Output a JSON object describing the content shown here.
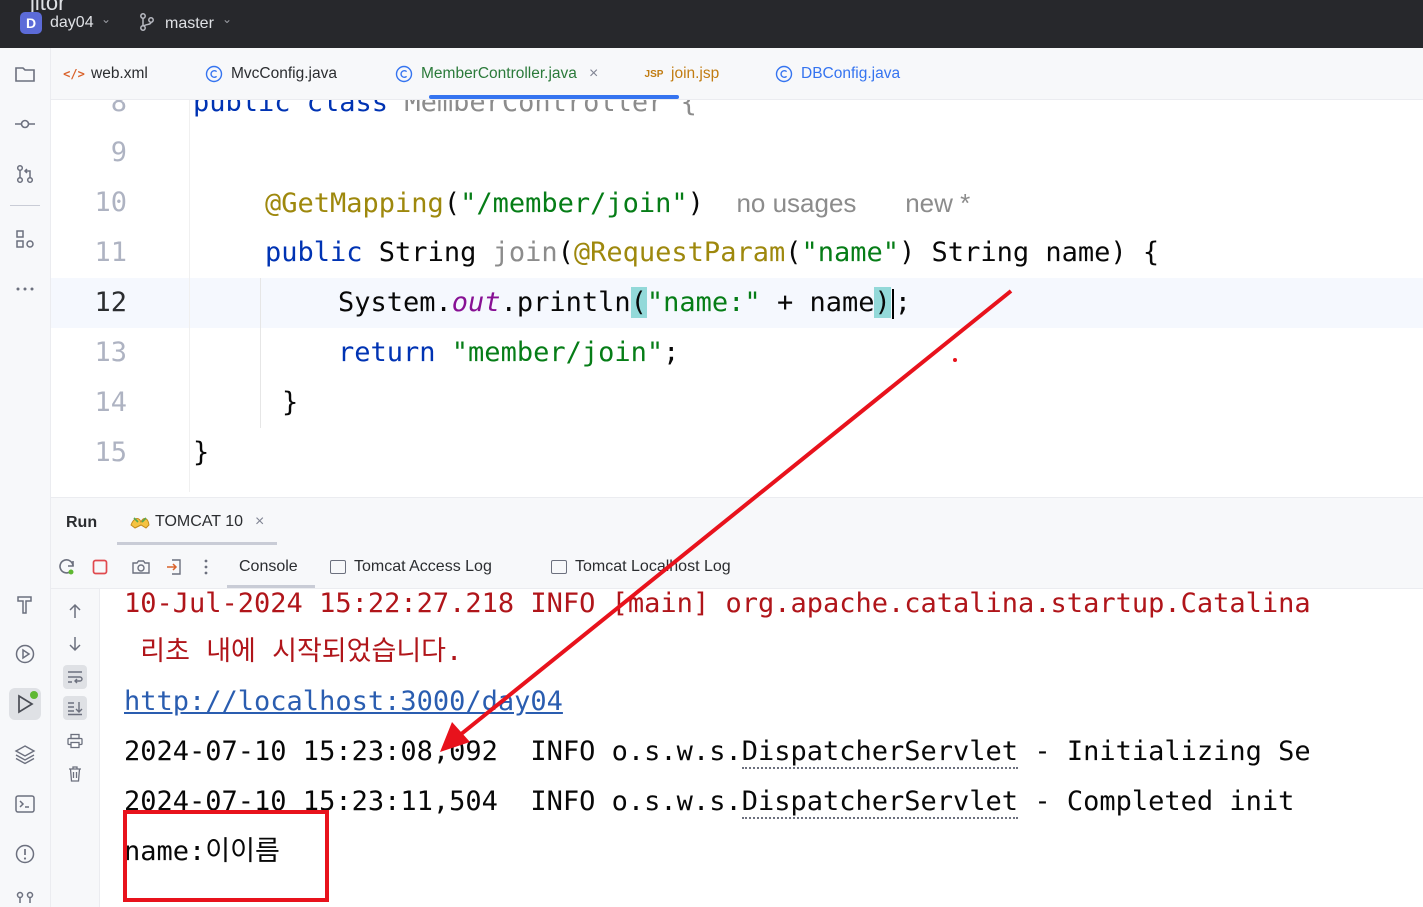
{
  "titlebar": {
    "logo_fragment": "jitor",
    "project_badge": "D",
    "project_name": "day04",
    "branch": "master"
  },
  "tabs": [
    {
      "label": "web.xml",
      "icon": "xml-icon",
      "active": false
    },
    {
      "label": "MvcConfig.java",
      "icon": "java-class-icon",
      "active": false
    },
    {
      "label": "MemberController.java",
      "icon": "java-class-icon",
      "active": true,
      "close": "×"
    },
    {
      "label": "join.jsp",
      "icon": "jsp-icon",
      "active": false,
      "badge": "JSP"
    },
    {
      "label": "DBConfig.java",
      "icon": "java-class-icon",
      "active": false
    }
  ],
  "editor": {
    "line_numbers": [
      "8",
      "9",
      "10",
      "11",
      "12",
      "13",
      "14",
      "15"
    ],
    "current_line": "12",
    "lines": {
      "l8": {
        "kw": "public class ",
        "name": "MemberController {"
      },
      "l10": {
        "annotation": "@GetMapping",
        "open": "(",
        "str": "\"/member/join\"",
        "close": ")",
        "hint_usages": "no usages",
        "hint_new": "new *"
      },
      "l11": {
        "kw": "public ",
        "type": "String ",
        "method": "join",
        "open": "(",
        "annotation": "@RequestParam",
        "p_open": "(",
        "str": "\"name\"",
        "p_close": ")",
        "rest": " String name) {"
      },
      "l12": {
        "sys": "System.",
        "field": "out",
        "call": ".println",
        "open": "(",
        "str": "\"name:\"",
        "rest": " + name",
        "close": ")",
        "semi": ";"
      },
      "l13": {
        "kw": "return ",
        "str": "\"member/join\"",
        "semi": ";"
      },
      "l14": {
        "text": "}"
      },
      "l15": {
        "text": "}"
      }
    }
  },
  "run_panel": {
    "title": "Run",
    "config_tab": "TOMCAT 10",
    "config_close": "×",
    "console_tabs": [
      "Console",
      "Tomcat Access Log",
      "Tomcat Localhost Log"
    ],
    "lines": {
      "c1": "10-Jul-2024 15:22:27.218 INFO [main] org.apache.catalina.startup.Catalina",
      "c2": " 리초 내에 시작되었습니다.",
      "c3": "http://localhost:3000/day04",
      "c4_pre": "2024-07-10 15:23:08,092  INFO o.s.w.s.",
      "c4_cls": "DispatcherServlet",
      "c4_post": " - Initializing Se",
      "c5_pre": "2024-07-10 15:23:11,504  INFO o.s.w.s.",
      "c5_cls": "DispatcherServlet",
      "c5_post": " - Completed init",
      "c6": "name:이이름"
    }
  },
  "colors": {
    "annotation_red": "#e8121c",
    "keyword": "#0033b3",
    "string": "#067d17",
    "annotation": "#9e880d",
    "error_text": "#b0151a"
  }
}
